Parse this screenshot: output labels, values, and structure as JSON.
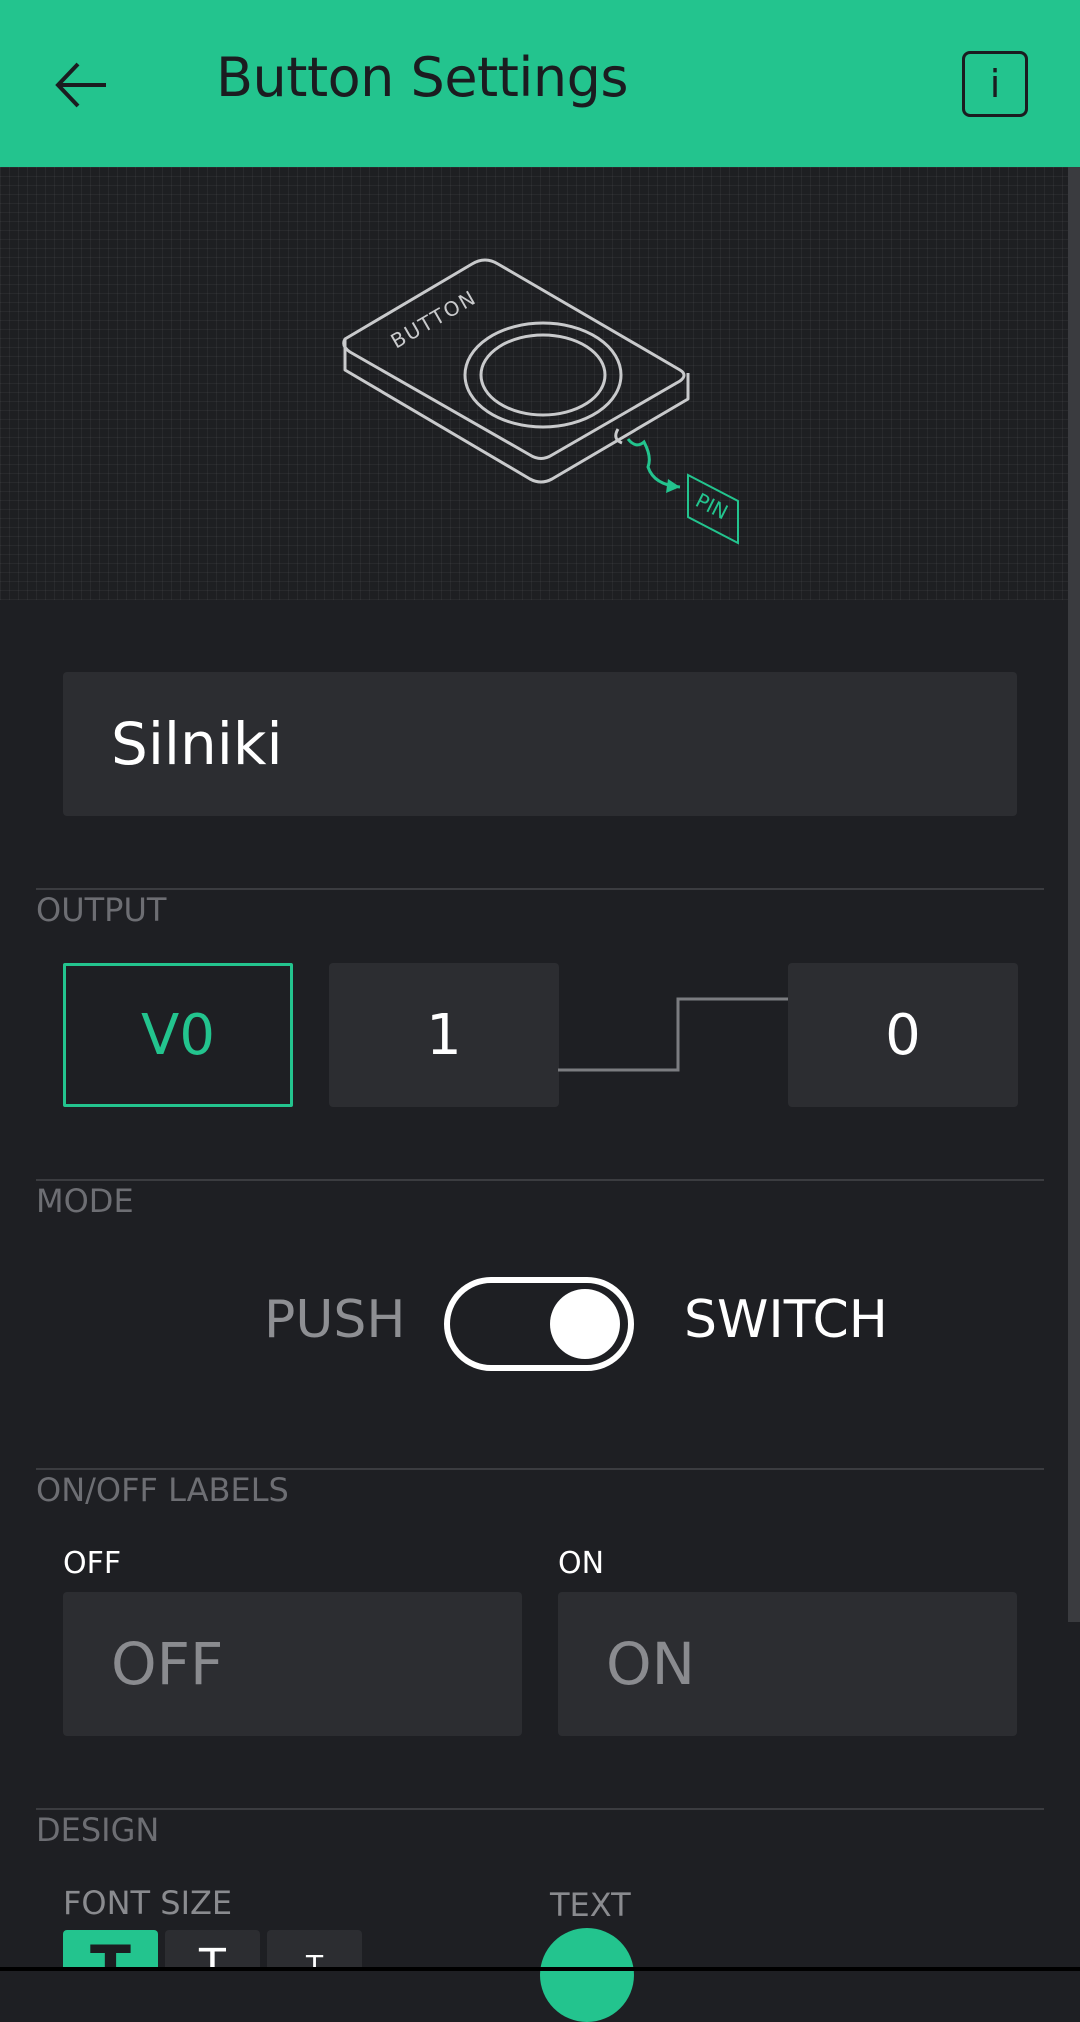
{
  "header": {
    "title": "Button Settings",
    "info_label": "i",
    "accent_color": "#23c48e"
  },
  "hero": {
    "device_label": "BUTTON",
    "pin_label": "PIN"
  },
  "name_field": {
    "value": "Silniki"
  },
  "output": {
    "section_label": "OUTPUT",
    "pin": "V0",
    "on_value": "1",
    "off_value": "0"
  },
  "mode": {
    "section_label": "MODE",
    "push_label": "PUSH",
    "switch_label": "SWITCH",
    "selected": "SWITCH"
  },
  "labels": {
    "section_label": "ON/OFF LABELS",
    "off_caption": "OFF",
    "on_caption": "ON",
    "off_placeholder": "OFF",
    "on_placeholder": "ON"
  },
  "design": {
    "section_label": "DESIGN",
    "font_size_label": "FONT SIZE",
    "text_label": "TEXT",
    "font_size_glyph": "T"
  },
  "colors": {
    "background": "#1e1f23",
    "field": "#2c2d31",
    "accent": "#23c48e"
  }
}
